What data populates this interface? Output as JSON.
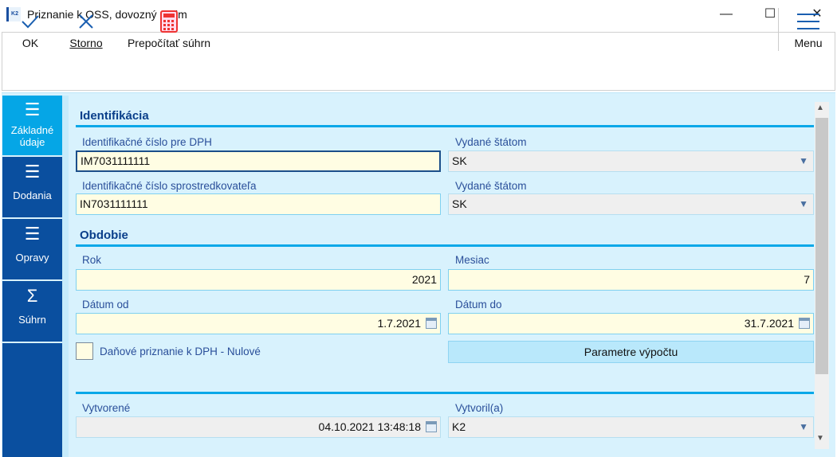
{
  "window": {
    "title": "Priznanie k OSS, dovozný režim",
    "app_icon": "K2",
    "minimize": "—",
    "maximize": "☐",
    "close": "✕"
  },
  "toolbar": {
    "ok": "OK",
    "storno": "Storno",
    "recalc": "Prepočítať súhrn",
    "menu": "Menu"
  },
  "sidebar": {
    "items": [
      {
        "label": "Základné údaje",
        "icon": "list-icon"
      },
      {
        "label": "Dodania",
        "icon": "menu-icon"
      },
      {
        "label": "Opravy",
        "icon": "menu-icon"
      },
      {
        "label": "Súhrn",
        "icon": "sigma-icon"
      }
    ]
  },
  "identification": {
    "title": "Identifikácia",
    "vat_label": "Identifikačné číslo pre DPH",
    "vat_value": "IM7031111111",
    "state1_label": "Vydané štátom",
    "state1_value": "SK",
    "intermediary_label": "Identifikačné číslo sprostredkovateľa",
    "intermediary_value": "IN7031111111",
    "state2_label": "Vydané štátom",
    "state2_value": "SK"
  },
  "period": {
    "title": "Obdobie",
    "year_label": "Rok",
    "year_value": "2021",
    "month_label": "Mesiac",
    "month_value": "7",
    "from_label": "Dátum od",
    "from_value": "1.7.2021",
    "to_label": "Dátum do",
    "to_value": "31.7.2021",
    "zero_label": "Daňové priznanie k DPH - Nulové",
    "params_button": "Parametre výpočtu"
  },
  "audit": {
    "created_label": "Vytvorené",
    "created_value": "04.10.2021 13:48:18",
    "author_label": "Vytvoril(a)",
    "author_value": "K2"
  },
  "colors": {
    "accent": "#05a6e6",
    "sidebar": "#0a4f9f",
    "background": "#d8f2fd"
  }
}
